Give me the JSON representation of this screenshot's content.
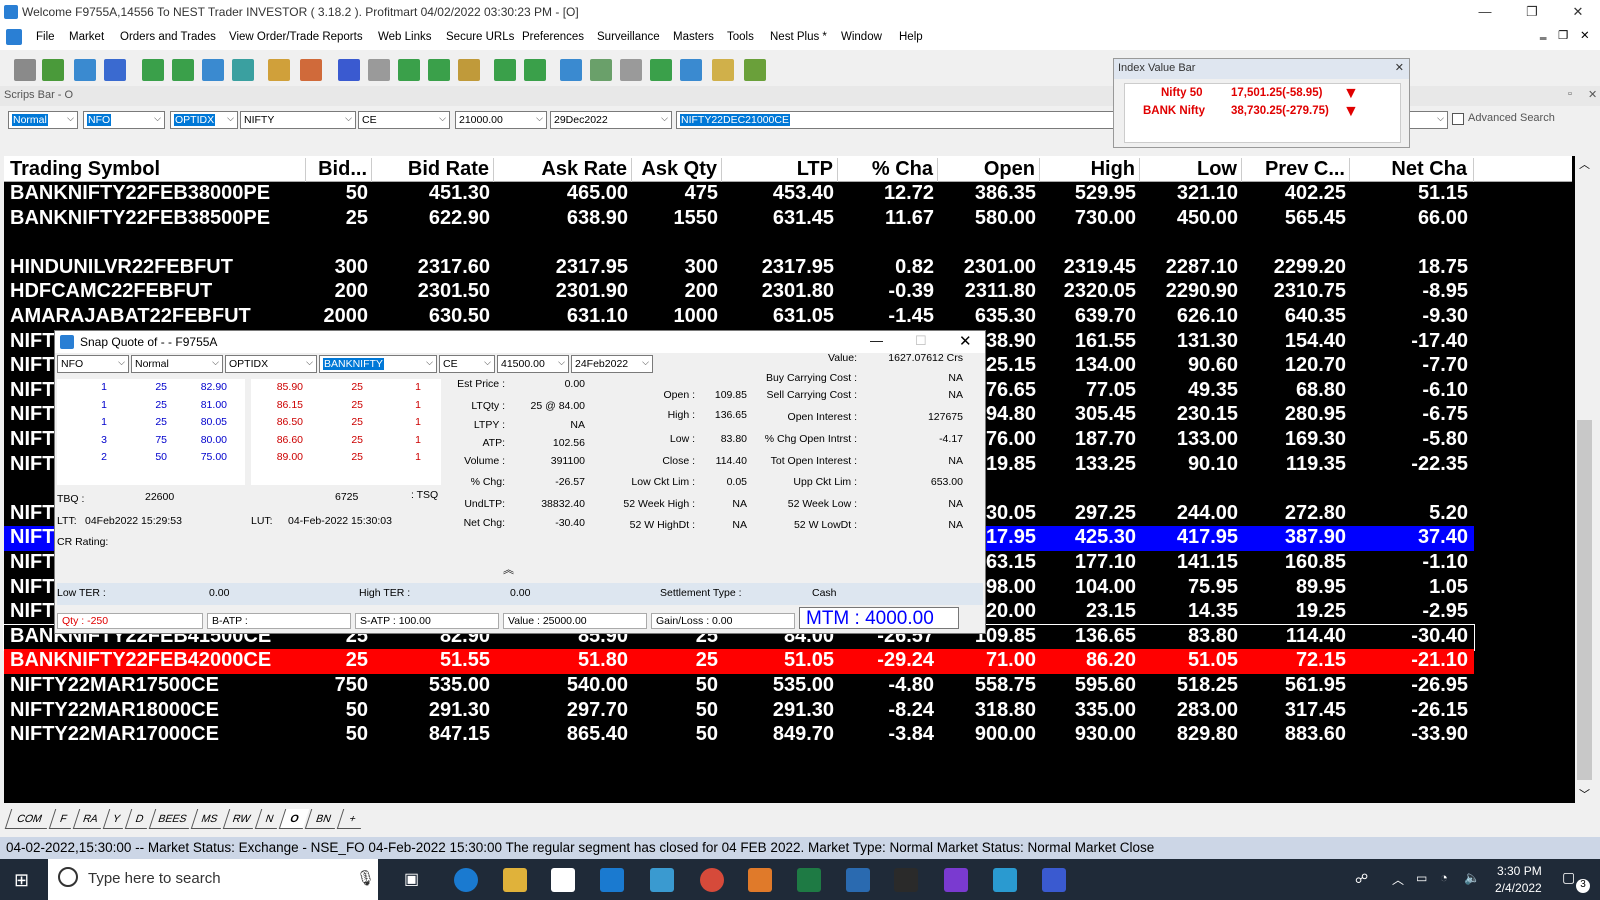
{
  "window": {
    "title": "Welcome F9755A,14556 To NEST Trader INVESTOR ( 3.18.2 ).  Profitmart  04/02/2022  03:30:23 PM - [O]",
    "controls": [
      "—",
      "❐",
      "✕"
    ]
  },
  "menu": [
    "File",
    "Market",
    "Orders and Trades",
    "View Order/Trade Reports",
    "Web Links",
    "Secure URLs",
    "Preferences",
    "Surveillance",
    "Masters",
    "Tools",
    "Nest Plus *",
    "Window",
    "Help"
  ],
  "scrips_bar": {
    "title": "Scrips Bar - O",
    "fields": [
      {
        "value": "Normal",
        "highlight": true
      },
      {
        "value": "NFO",
        "highlight": true
      },
      {
        "value": "OPTIDX",
        "highlight": true
      },
      {
        "value": "NIFTY",
        "highlight": false
      },
      {
        "value": "CE",
        "highlight": false
      },
      {
        "value": "21000.00",
        "highlight": false
      },
      {
        "value": "29Dec2022",
        "highlight": false
      },
      {
        "value": "NIFTY22DEC21000CE",
        "highlight": true
      }
    ],
    "advanced_search": "Advanced Search"
  },
  "index_bar": {
    "title": "Index Value Bar",
    "items": [
      {
        "name": "Nifty 50",
        "value": "17,501.25(-58.95)"
      },
      {
        "name": "BANK Nifty",
        "value": "38,730.25(-279.75)"
      }
    ]
  },
  "market_watch": {
    "columns": [
      "Trading Symbol",
      "Bid...",
      "Bid Rate",
      "Ask Rate",
      "Ask Qty",
      "LTP",
      "% Cha",
      "Open",
      "High",
      "Low",
      "Prev C...",
      "Net Cha"
    ],
    "rows": [
      {
        "sym": "BANKNIFTY22FEB38000PE",
        "bidq": "50",
        "bid": "451.30",
        "ask": "465.00",
        "askq": "475",
        "ltp": "453.40",
        "pct": "12.72",
        "open": "386.35",
        "high": "529.95",
        "low": "321.10",
        "prev": "402.25",
        "net": "51.15",
        "style": "normal"
      },
      {
        "sym": "BANKNIFTY22FEB38500PE",
        "bidq": "25",
        "bid": "622.90",
        "ask": "638.90",
        "askq": "1550",
        "ltp": "631.45",
        "pct": "11.67",
        "open": "580.00",
        "high": "730.00",
        "low": "450.00",
        "prev": "565.45",
        "net": "66.00",
        "style": "normal"
      },
      {
        "sym": "",
        "bidq": "",
        "bid": "",
        "ask": "",
        "askq": "",
        "ltp": "",
        "pct": "",
        "open": "",
        "high": "",
        "low": "",
        "prev": "",
        "net": "",
        "style": "normal"
      },
      {
        "sym": "HINDUNILVR22FEBFUT",
        "bidq": "300",
        "bid": "2317.60",
        "ask": "2317.95",
        "askq": "300",
        "ltp": "2317.95",
        "pct": "0.82",
        "open": "2301.00",
        "high": "2319.45",
        "low": "2287.10",
        "prev": "2299.20",
        "net": "18.75",
        "style": "normal"
      },
      {
        "sym": "HDFCAMC22FEBFUT",
        "bidq": "200",
        "bid": "2301.50",
        "ask": "2301.90",
        "askq": "200",
        "ltp": "2301.80",
        "pct": "-0.39",
        "open": "2311.80",
        "high": "2320.05",
        "low": "2290.90",
        "prev": "2310.75",
        "net": "-8.95",
        "style": "normal"
      },
      {
        "sym": "AMARAJABAT22FEBFUT",
        "bidq": "2000",
        "bid": "630.50",
        "ask": "631.10",
        "askq": "1000",
        "ltp": "631.05",
        "pct": "-1.45",
        "open": "635.30",
        "high": "639.70",
        "low": "626.10",
        "prev": "640.35",
        "net": "-9.30",
        "style": "normal"
      },
      {
        "sym": "NIFT",
        "bidq": "",
        "bid": "",
        "ask": "",
        "askq": "",
        "ltp": "",
        "pct": "",
        "open": "38.90",
        "high": "161.55",
        "low": "131.30",
        "prev": "154.40",
        "net": "-17.40",
        "style": "normal"
      },
      {
        "sym": "NIFT",
        "bidq": "",
        "bid": "",
        "ask": "",
        "askq": "",
        "ltp": "",
        "pct": "",
        "open": "25.15",
        "high": "134.00",
        "low": "90.60",
        "prev": "120.70",
        "net": "-7.70",
        "style": "normal"
      },
      {
        "sym": "NIFT",
        "bidq": "",
        "bid": "",
        "ask": "",
        "askq": "",
        "ltp": "",
        "pct": "",
        "open": "76.65",
        "high": "77.05",
        "low": "49.35",
        "prev": "68.80",
        "net": "-6.10",
        "style": "normal"
      },
      {
        "sym": "NIFT",
        "bidq": "",
        "bid": "",
        "ask": "",
        "askq": "",
        "ltp": "",
        "pct": "",
        "open": "94.80",
        "high": "305.45",
        "low": "230.15",
        "prev": "280.95",
        "net": "-6.75",
        "style": "normal"
      },
      {
        "sym": "NIFT",
        "bidq": "",
        "bid": "",
        "ask": "",
        "askq": "",
        "ltp": "",
        "pct": "",
        "open": "76.00",
        "high": "187.70",
        "low": "133.00",
        "prev": "169.30",
        "net": "-5.80",
        "style": "normal"
      },
      {
        "sym": "NIFT",
        "bidq": "",
        "bid": "",
        "ask": "",
        "askq": "",
        "ltp": "",
        "pct": "",
        "open": "19.85",
        "high": "133.25",
        "low": "90.10",
        "prev": "119.35",
        "net": "-22.35",
        "style": "normal"
      },
      {
        "sym": "",
        "bidq": "",
        "bid": "",
        "ask": "",
        "askq": "",
        "ltp": "",
        "pct": "",
        "open": "",
        "high": "",
        "low": "",
        "prev": "",
        "net": "",
        "style": "normal"
      },
      {
        "sym": "NIFT",
        "bidq": "",
        "bid": "",
        "ask": "",
        "askq": "",
        "ltp": "",
        "pct": "",
        "open": "30.05",
        "high": "297.25",
        "low": "244.00",
        "prev": "272.80",
        "net": "5.20",
        "style": "normal"
      },
      {
        "sym": "NIFT",
        "bidq": "",
        "bid": "",
        "ask": "",
        "askq": "",
        "ltp": "",
        "pct": "",
        "open": "17.95",
        "high": "425.30",
        "low": "417.95",
        "prev": "387.90",
        "net": "37.40",
        "style": "blue"
      },
      {
        "sym": "NIFT",
        "bidq": "",
        "bid": "",
        "ask": "",
        "askq": "",
        "ltp": "",
        "pct": "",
        "open": "63.15",
        "high": "177.10",
        "low": "141.15",
        "prev": "160.85",
        "net": "-1.10",
        "style": "normal"
      },
      {
        "sym": "NIFT",
        "bidq": "",
        "bid": "",
        "ask": "",
        "askq": "",
        "ltp": "",
        "pct": "",
        "open": "98.00",
        "high": "104.00",
        "low": "75.95",
        "prev": "89.95",
        "net": "1.05",
        "style": "normal"
      },
      {
        "sym": "NIFT",
        "bidq": "",
        "bid": "",
        "ask": "",
        "askq": "",
        "ltp": "",
        "pct": "",
        "open": "20.00",
        "high": "23.15",
        "low": "14.35",
        "prev": "19.25",
        "net": "-2.95",
        "style": "normal"
      },
      {
        "sym": "BANKNIFTY22FEB41500CE",
        "bidq": "25",
        "bid": "82.90",
        "ask": "85.90",
        "askq": "25",
        "ltp": "84.00",
        "pct": "-26.57",
        "open": "109.85",
        "high": "136.65",
        "low": "83.80",
        "prev": "114.40",
        "net": "-30.40",
        "style": "selected"
      },
      {
        "sym": "BANKNIFTY22FEB42000CE",
        "bidq": "25",
        "bid": "51.55",
        "ask": "51.80",
        "askq": "25",
        "ltp": "51.05",
        "pct": "-29.24",
        "open": "71.00",
        "high": "86.20",
        "low": "51.05",
        "prev": "72.15",
        "net": "-21.10",
        "style": "red"
      },
      {
        "sym": "NIFTY22MAR17500CE",
        "bidq": "750",
        "bid": "535.00",
        "ask": "540.00",
        "askq": "50",
        "ltp": "535.00",
        "pct": "-4.80",
        "open": "558.75",
        "high": "595.60",
        "low": "518.25",
        "prev": "561.95",
        "net": "-26.95",
        "style": "normal"
      },
      {
        "sym": "NIFTY22MAR18000CE",
        "bidq": "50",
        "bid": "291.30",
        "ask": "297.70",
        "askq": "50",
        "ltp": "291.30",
        "pct": "-8.24",
        "open": "318.80",
        "high": "335.00",
        "low": "283.00",
        "prev": "317.45",
        "net": "-26.15",
        "style": "normal"
      },
      {
        "sym": "NIFTY22MAR17000CE",
        "bidq": "50",
        "bid": "847.15",
        "ask": "865.40",
        "askq": "50",
        "ltp": "849.70",
        "pct": "-3.84",
        "open": "900.00",
        "high": "930.00",
        "low": "829.80",
        "prev": "883.60",
        "net": "-33.90",
        "style": "normal"
      }
    ]
  },
  "snap_quote": {
    "title": "Snap Quote of  -  - F9755A",
    "fields": [
      "NFO",
      "Normal",
      "OPTIDX",
      "BANKNIFTY",
      "CE",
      "41500.00",
      "24Feb2022"
    ],
    "bids": [
      [
        "1",
        "25",
        "82.90"
      ],
      [
        "1",
        "25",
        "81.00"
      ],
      [
        "1",
        "25",
        "80.05"
      ],
      [
        "3",
        "75",
        "80.00"
      ],
      [
        "2",
        "50",
        "75.00"
      ]
    ],
    "asks": [
      [
        "85.90",
        "25",
        "1"
      ],
      [
        "86.15",
        "25",
        "1"
      ],
      [
        "86.50",
        "25",
        "1"
      ],
      [
        "86.60",
        "25",
        "1"
      ],
      [
        "89.00",
        "25",
        "1"
      ]
    ],
    "tbq_label": "TBQ :",
    "tbq": "22600",
    "tsq": "6725",
    "tsq_label": ": TSQ",
    "ltt_label": "LTT:",
    "ltt": "04Feb2022 15:29:53",
    "lut_label": "LUT:",
    "lut": "04-Feb-2022 15:30:03",
    "cr_rating": "CR Rating:",
    "col1": [
      {
        "label": "Est Price :",
        "value": "0.00"
      },
      {
        "label": "LTQty :",
        "value": "25 @ 84.00"
      },
      {
        "label": "LTPY :",
        "value": "NA"
      },
      {
        "label": "ATP:",
        "value": "102.56"
      },
      {
        "label": "Volume :",
        "value": "391100"
      },
      {
        "label": "% Chg:",
        "value": "-26.57"
      },
      {
        "label": "UndLTP:",
        "value": "38832.40"
      },
      {
        "label": "Net Chg:",
        "value": "-30.40"
      }
    ],
    "col2": [
      {
        "label": "Open :",
        "value": "109.85"
      },
      {
        "label": "High :",
        "value": "136.65"
      },
      {
        "label": "Low :",
        "value": "83.80"
      },
      {
        "label": "Close :",
        "value": "114.40"
      },
      {
        "label": "Low Ckt Lim :",
        "value": "0.05"
      },
      {
        "label": "52 Week High :",
        "value": "NA"
      },
      {
        "label": "52 W HighDt :",
        "value": "NA"
      }
    ],
    "col3": [
      {
        "label": "Value:",
        "value": "1627.07612 Crs"
      },
      {
        "label": "Buy Carrying Cost :",
        "value": "NA"
      },
      {
        "label": "Sell Carrying Cost :",
        "value": "NA"
      },
      {
        "label": "Open Interest :",
        "value": "127675"
      },
      {
        "label": "% Chg Open Intrst :",
        "value": "-4.17"
      },
      {
        "label": "Tot Open Interest :",
        "value": "NA"
      },
      {
        "label": "Upp Ckt Lim :",
        "value": "653.00"
      },
      {
        "label": "52 Week Low :",
        "value": "NA"
      },
      {
        "label": "52 W LowDt :",
        "value": "NA"
      }
    ],
    "low_ter_label": "Low TER :",
    "low_ter": "0.00",
    "high_ter_label": "High TER :",
    "high_ter": "0.00",
    "settlement_label": "Settlement Type :",
    "settlement": "Cash",
    "bottom": [
      "Qty : -250",
      "B-ATP :",
      "S-ATP : 100.00",
      "Value : 25000.00",
      "Gain/Loss : 0.00"
    ],
    "mtm": "MTM : 4000.00"
  },
  "tabs": [
    "COM",
    "F",
    "RA",
    "Y",
    "D",
    "BEES",
    "MS",
    "RW",
    "N",
    "O",
    "BN",
    "+"
  ],
  "active_tab": "O",
  "status": "04-02-2022,15:30:00  -- Market Status: Exchange - NSE_FO 04-Feb-2022 15:30:00 The regular segment has closed for 04 FEB 2022. Market Type: Normal Market  Status: Normal Market Close",
  "taskbar": {
    "search_placeholder": "Type here to search",
    "time": "3:30 PM",
    "date": "2/4/2022",
    "notifications": "3"
  },
  "colors": {
    "red": "#ff0000",
    "blue": "#0000ff",
    "bg": "#000000"
  }
}
